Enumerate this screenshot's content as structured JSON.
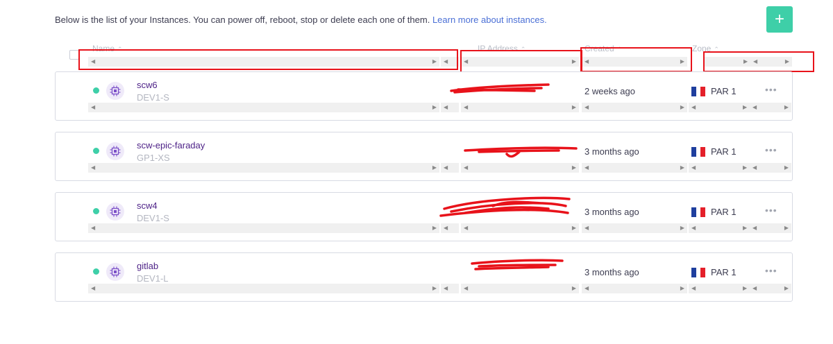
{
  "intro": {
    "text": "Below is the list of your Instances. You can power off, reboot, stop or delete each one of them.",
    "link": "Learn more about instances."
  },
  "add_button": {
    "label": "+"
  },
  "columns": {
    "name": "Name",
    "ip": "IP Address",
    "created": "Created",
    "zone": "Zone",
    "sort_glyph": "⌃"
  },
  "scroll": {
    "left": "◀",
    "right": "▶"
  },
  "rows": [
    {
      "name": "scw6",
      "type": "DEV1-S",
      "created": "2 weeks ago",
      "zone": "PAR 1",
      "status": "running"
    },
    {
      "name": "scw-epic-faraday",
      "type": "GP1-XS",
      "created": "3 months ago",
      "zone": "PAR 1",
      "status": "running"
    },
    {
      "name": "scw4",
      "type": "DEV1-S",
      "created": "3 months ago",
      "zone": "PAR 1",
      "status": "running"
    },
    {
      "name": "gitlab",
      "type": "DEV1-L",
      "created": "3 months ago",
      "zone": "PAR 1",
      "status": "running"
    }
  ],
  "more_glyph": "•••",
  "colors": {
    "accent": "#3ecfa8",
    "name_text": "#4b1f86",
    "link": "#4a6fd6",
    "annotation": "#e8121a",
    "flag": [
      "#1f3f9e",
      "#ffffff",
      "#e4202a"
    ]
  },
  "icons": {
    "row_icon": "cpu-chip-icon",
    "status": "status-dot",
    "zone_flag": "france-flag-icon",
    "more": "more-options-icon"
  }
}
